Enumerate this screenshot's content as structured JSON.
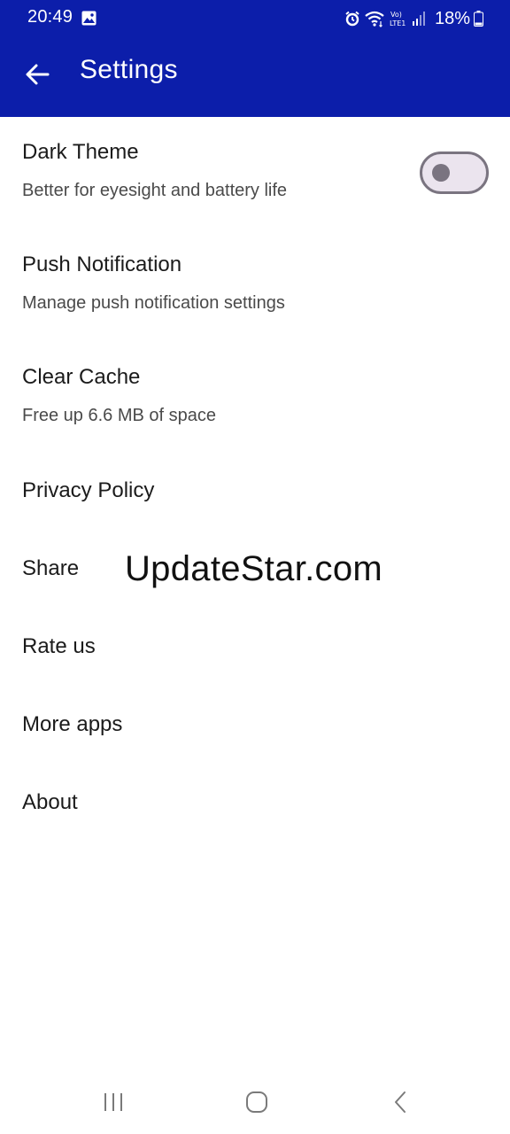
{
  "status_bar": {
    "time": "20:49",
    "battery_percent": "18%",
    "icons": [
      "gallery-icon",
      "alarm-icon",
      "wifi-icon",
      "volte-icon",
      "signal-icon",
      "battery-icon"
    ]
  },
  "app_bar": {
    "title": "Settings",
    "back_icon": "arrow-left-icon",
    "background_color": "#0c1eaa"
  },
  "settings": {
    "dark_theme": {
      "title": "Dark Theme",
      "subtitle": "Better for eyesight and battery life",
      "enabled": false
    },
    "push_notification": {
      "title": "Push Notification",
      "subtitle": "Manage push notification settings"
    },
    "clear_cache": {
      "title": "Clear Cache",
      "subtitle": "Free up 6.6 MB of space"
    },
    "privacy_policy": {
      "title": "Privacy Policy"
    },
    "share": {
      "title": "Share"
    },
    "rate_us": {
      "title": "Rate us"
    },
    "more_apps": {
      "title": "More apps"
    },
    "about": {
      "title": "About"
    }
  },
  "watermark": "UpdateStar.com",
  "nav_bar": {
    "icons": [
      "recent-apps-icon",
      "home-icon",
      "back-icon"
    ]
  }
}
